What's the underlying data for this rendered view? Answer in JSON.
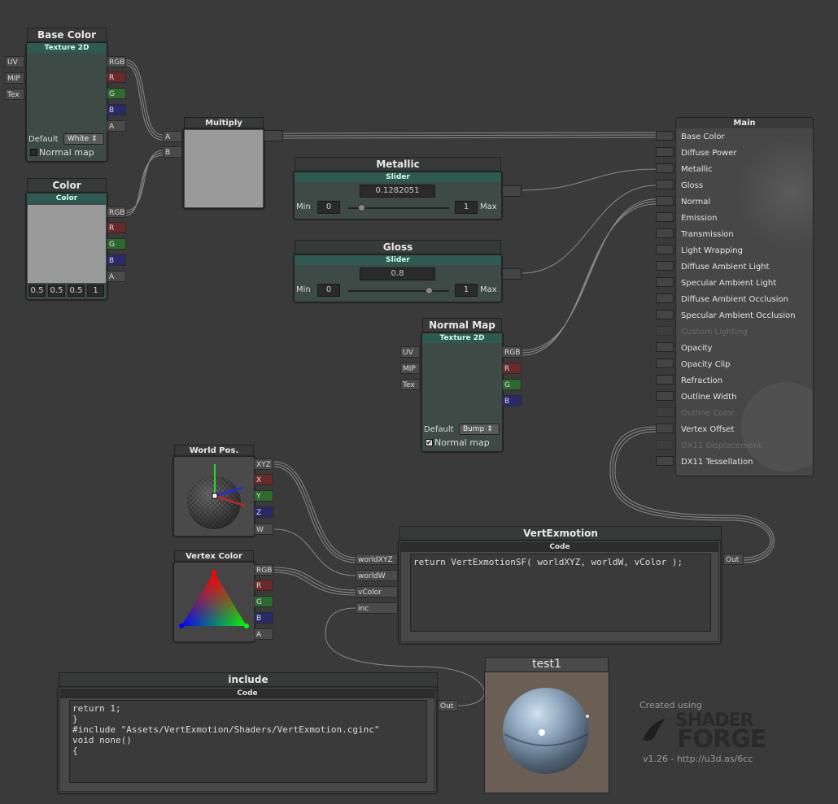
{
  "nodes": {
    "base_color": {
      "title": "Base Color",
      "subtitle": "Texture 2D",
      "inputs": [
        "UV",
        "MIP",
        "Tex"
      ],
      "outputs": [
        "RGB",
        "R",
        "G",
        "B",
        "A"
      ],
      "default_label": "Default",
      "default_value": "White",
      "normal_map_label": "Normal map",
      "normal_map_checked": false
    },
    "color": {
      "title": "Color",
      "subtitle": "Color",
      "outputs": [
        "RGB",
        "R",
        "G",
        "B",
        "A"
      ],
      "values": [
        "0.5",
        "0.5",
        "0.5",
        "1"
      ],
      "swatch": "#9a9a9a"
    },
    "multiply": {
      "title": "Multiply",
      "inputs": [
        "A",
        "B"
      ],
      "preview": "#9a9a9a"
    },
    "metallic": {
      "title": "Metallic",
      "subtitle": "Slider",
      "value": "0.1282051",
      "min_label": "Min",
      "min": "0",
      "max": "1",
      "max_label": "Max",
      "level": 0.128
    },
    "gloss": {
      "title": "Gloss",
      "subtitle": "Slider",
      "value": "0.8",
      "min_label": "Min",
      "min": "0",
      "max": "1",
      "max_label": "Max",
      "level": 0.8
    },
    "normal_map": {
      "title": "Normal Map",
      "subtitle": "Texture 2D",
      "inputs": [
        "UV",
        "MIP",
        "Tex"
      ],
      "outputs": [
        "RGB",
        "R",
        "G",
        "B"
      ],
      "default_label": "Default",
      "default_value": "Bump",
      "normal_map_label": "Normal map",
      "normal_map_checked": true
    },
    "world_pos": {
      "title": "World Pos.",
      "outputs": [
        "XYZ",
        "X",
        "Y",
        "Z",
        "W"
      ]
    },
    "vertex_color": {
      "title": "Vertex Color",
      "outputs": [
        "RGB",
        "R",
        "G",
        "B",
        "A"
      ]
    },
    "vertexmotion": {
      "title": "VertExmotion",
      "subtitle": "Code",
      "inputs": [
        "worldXYZ",
        "worldW",
        "vColor",
        "inc"
      ],
      "output": "Out",
      "code": "return VertExmotionSF( worldXYZ, worldW, vColor );"
    },
    "include": {
      "title": "include",
      "subtitle": "Code",
      "output": "Out",
      "code": "return 1;\n}\n#include \"Assets/VertExmotion/Shaders/VertExmotion.cginc\"\nvoid none()\n{"
    },
    "test1": {
      "title": "test1"
    },
    "main": {
      "title": "Main",
      "inputs": [
        {
          "label": "Base Color",
          "enabled": true
        },
        {
          "label": "Diffuse Power",
          "enabled": true
        },
        {
          "label": "Metallic",
          "enabled": true
        },
        {
          "label": "Gloss",
          "enabled": true
        },
        {
          "label": "Normal",
          "enabled": true
        },
        {
          "label": "Emission",
          "enabled": true
        },
        {
          "label": "Transmission",
          "enabled": true
        },
        {
          "label": "Light Wrapping",
          "enabled": true
        },
        {
          "label": "Diffuse Ambient Light",
          "enabled": true
        },
        {
          "label": "Specular Ambient Light",
          "enabled": true
        },
        {
          "label": "Diffuse Ambient Occlusion",
          "enabled": true
        },
        {
          "label": "Specular Ambient Occlusion",
          "enabled": true
        },
        {
          "label": "Custom Lighting",
          "enabled": false
        },
        {
          "label": "Opacity",
          "enabled": true
        },
        {
          "label": "Opacity Clip",
          "enabled": true
        },
        {
          "label": "Refraction",
          "enabled": true
        },
        {
          "label": "Outline Width",
          "enabled": true
        },
        {
          "label": "Outline Color",
          "enabled": false
        },
        {
          "label": "Vertex Offset",
          "enabled": true
        },
        {
          "label": "DX11 Displacement",
          "enabled": false
        },
        {
          "label": "DX11 Tessellation",
          "enabled": true
        }
      ]
    }
  },
  "branding": {
    "created_using": "Created using",
    "logo_line1": "SHADER",
    "logo_line2": "FORGE",
    "version": "v1.26 - http://u3d.as/6cc"
  },
  "colors": {
    "background": "#3a3a3a",
    "node_body": "#3d4a46",
    "node_subtitle": "#2f5a52",
    "port_r": "#6a2a2a",
    "port_g": "#2d6a2d",
    "port_b": "#2a2a6a",
    "wire": "#888888"
  }
}
